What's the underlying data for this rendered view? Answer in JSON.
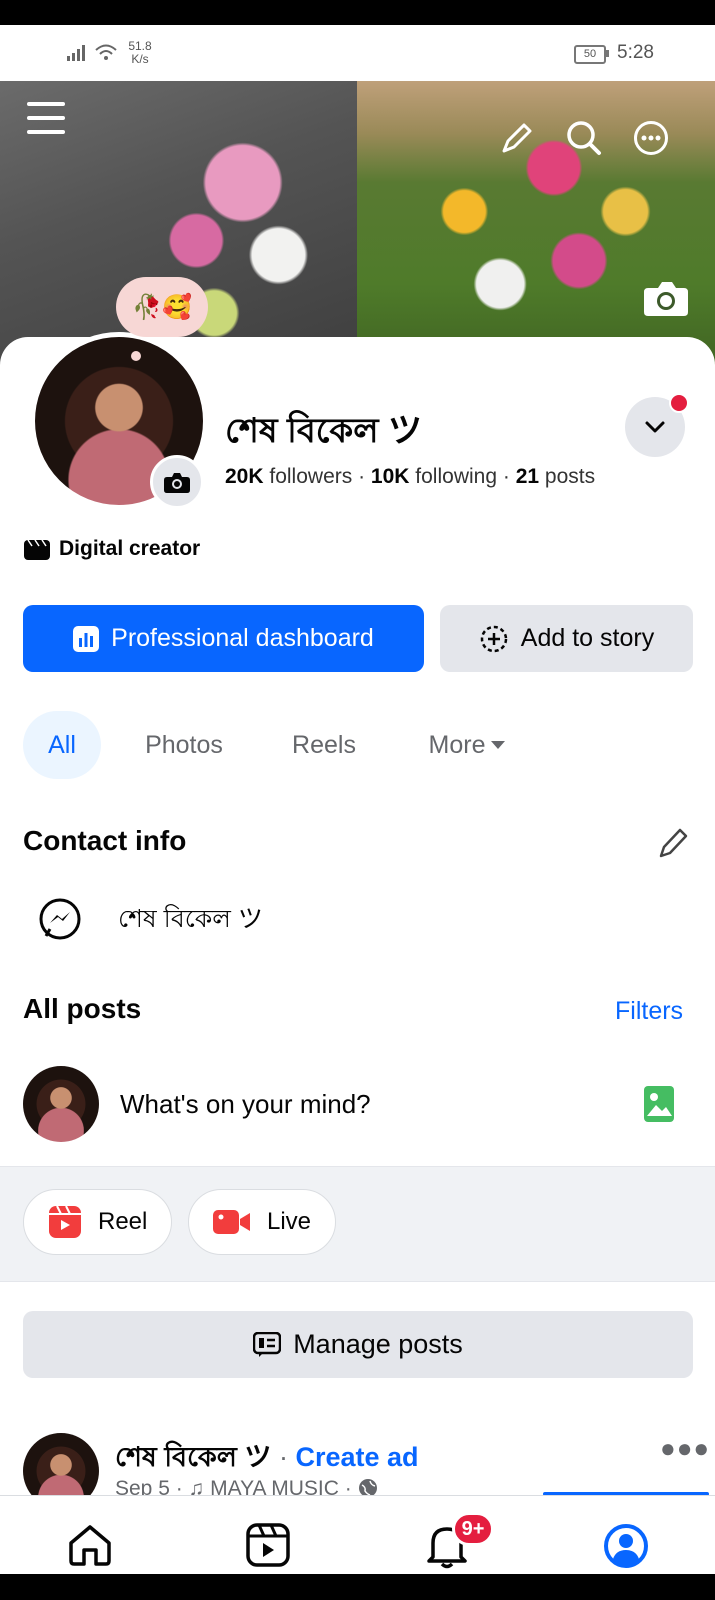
{
  "status_bar": {
    "net_speed_value": "51.8",
    "net_speed_unit": "K/s",
    "battery": "50",
    "time": "5:28"
  },
  "profile": {
    "status_emoji": "🥀🥰",
    "name": "শেষ বিকেল ツ",
    "followers_count": "20K",
    "followers_label": "followers",
    "following_count": "10K",
    "following_label": "following",
    "posts_count": "21",
    "posts_label": "posts",
    "category": "Digital creator"
  },
  "buttons": {
    "professional_dashboard": "Professional dashboard",
    "add_to_story": "Add to story"
  },
  "tabs": [
    {
      "label": "All"
    },
    {
      "label": "Photos"
    },
    {
      "label": "Reels"
    },
    {
      "label": "More"
    }
  ],
  "contact": {
    "title": "Contact info",
    "messenger_name": "শেষ বিকেল ツ"
  },
  "posts_section": {
    "title": "All posts",
    "filters": "Filters",
    "composer_placeholder": "What's on your mind?",
    "reel": "Reel",
    "live": "Live",
    "manage_posts": "Manage posts"
  },
  "post": {
    "author": "শেষ বিকেল ツ",
    "separator": "·",
    "create_ad": "Create ad",
    "meta": "Sep 5 · ♫ MAYA MUSIC ·"
  },
  "nav": {
    "notifications_badge": "9+"
  },
  "colors": {
    "brand_blue": "#0866ff",
    "badge_red": "#e41e3f"
  }
}
